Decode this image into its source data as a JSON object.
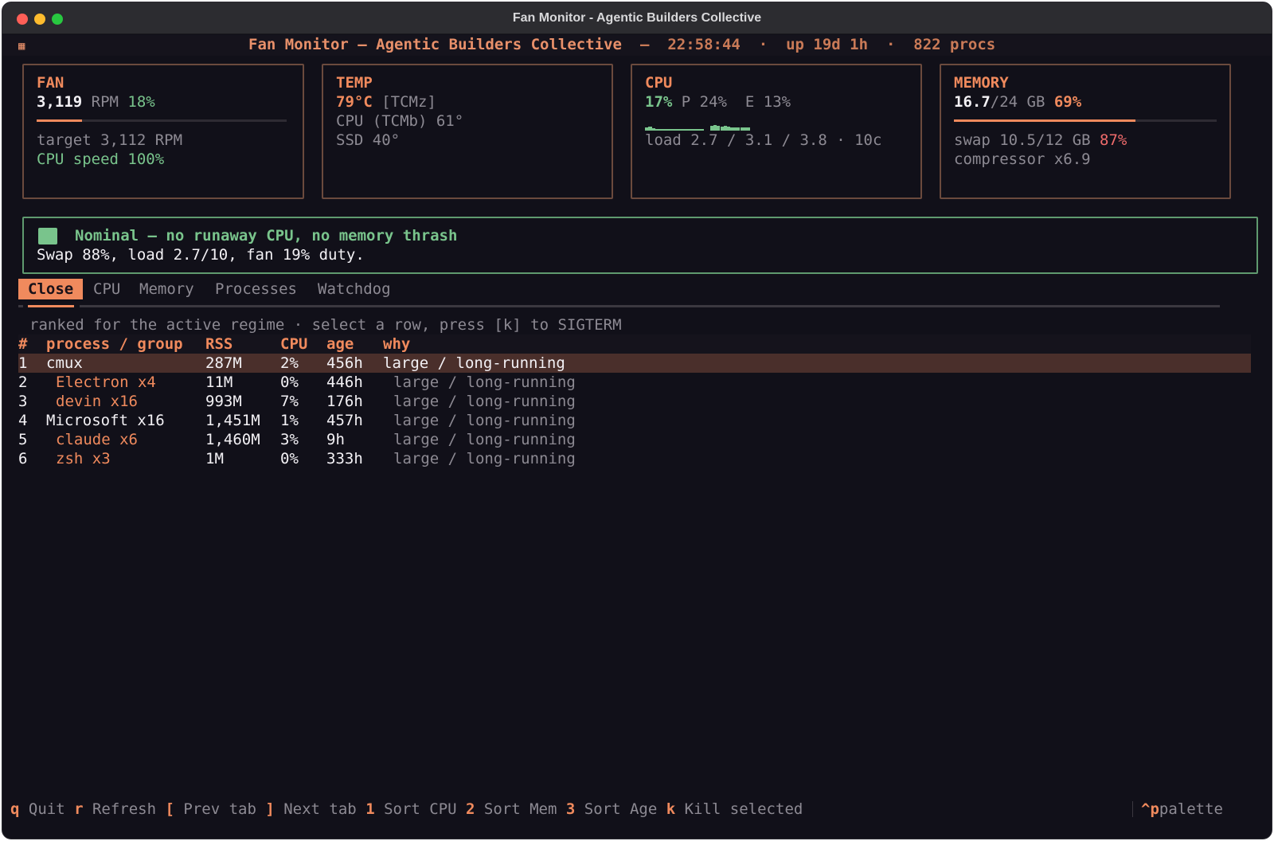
{
  "window": {
    "title": "Fan Monitor - Agentic Builders Collective"
  },
  "header": {
    "icon": "app-icon",
    "title": "Fan Monitor — Agentic Builders Collective",
    "dash": "—",
    "time": "22:58:44",
    "dot": "·",
    "uptime": "up 19d 1h",
    "procs": "822 procs"
  },
  "fan": {
    "title": "FAN",
    "rpm": "3,119",
    "unit": " RPM ",
    "pct": "18%",
    "bar_fraction": 0.18,
    "target": "target 3,112 RPM",
    "cpu_speed": "CPU speed 100%"
  },
  "temp": {
    "title": "TEMP",
    "value": "79°C",
    "sensor": " [TCMz]",
    "cpu": "CPU (TCMb) 61°",
    "ssd": "SSD 40°"
  },
  "cpu": {
    "title": "CPU",
    "total": "17%",
    "p_label": " P ",
    "p_value": "24%",
    "e_label": "  E ",
    "e_value": "13%",
    "load": "load 2.7 / 3.1 / 3.8 · 10c",
    "p_cores": [
      0.45,
      0.55,
      0.35,
      0.25,
      0.25,
      0.2,
      0.2,
      0.2,
      0.2,
      0.2,
      0.2,
      0.2,
      0.2,
      0.2,
      0.2,
      0.2,
      0.2
    ],
    "e_cores": [
      0.6,
      0.7,
      0.6,
      0.55,
      0.6,
      0.5,
      0.4,
      0.4,
      0.4,
      0.4,
      0.4,
      0.4
    ]
  },
  "memory": {
    "title": "MEMORY",
    "used": "16.7",
    "total": "/24 GB ",
    "pct": "69%",
    "bar_fraction": 0.69,
    "swap": "swap 10.5/12 GB ",
    "swap_pct": "87%",
    "compressor": "compressor x6.9"
  },
  "status": {
    "headline": "Nominal — no runaway CPU, no memory thrash",
    "detail": "Swap 88%, load 2.7/10, fan 19% duty."
  },
  "tabs": [
    "Close",
    "CPU",
    "Memory",
    "Processes",
    "Watchdog"
  ],
  "hint": "ranked for the active regime · select a row, press [k] to SIGTERM",
  "table": {
    "headers": [
      "#",
      "process / group",
      "RSS",
      "CPU",
      "age",
      "why"
    ],
    "rows": [
      {
        "num": "1",
        "name": "cmux",
        "rss": "287M",
        "cpu": "2%",
        "age": "456h",
        "why": "large / long-running"
      },
      {
        "num": "2",
        "name": "Electron x4",
        "rss": "11M",
        "cpu": "0%",
        "age": "446h",
        "why": "large / long-running"
      },
      {
        "num": "3",
        "name": "devin x16",
        "rss": "993M",
        "cpu": "7%",
        "age": "176h",
        "why": "large / long-running"
      },
      {
        "num": "4",
        "name": "Microsoft x16",
        "rss": "1,451M",
        "cpu": "1%",
        "age": "457h",
        "why": "large / long-running"
      },
      {
        "num": "5",
        "name": "claude x6",
        "rss": "1,460M",
        "cpu": "3%",
        "age": "9h",
        "why": "large / long-running"
      },
      {
        "num": "6",
        "name": "zsh x3",
        "rss": "1M",
        "cpu": "0%",
        "age": "333h",
        "why": "large / long-running"
      }
    ]
  },
  "footer": {
    "keys": [
      {
        "key": "q",
        "label": " Quit "
      },
      {
        "key": "r",
        "label": " Refresh "
      },
      {
        "key": "[",
        "label": " Prev tab "
      },
      {
        "key": "]",
        "label": " Next tab "
      },
      {
        "key": "1",
        "label": " Sort CPU "
      },
      {
        "key": "2",
        "label": " Sort Mem "
      },
      {
        "key": "3",
        "label": " Sort Age "
      },
      {
        "key": "k",
        "label": " Kill selected"
      }
    ],
    "palette_key": "^p",
    "palette_label": "palette"
  }
}
